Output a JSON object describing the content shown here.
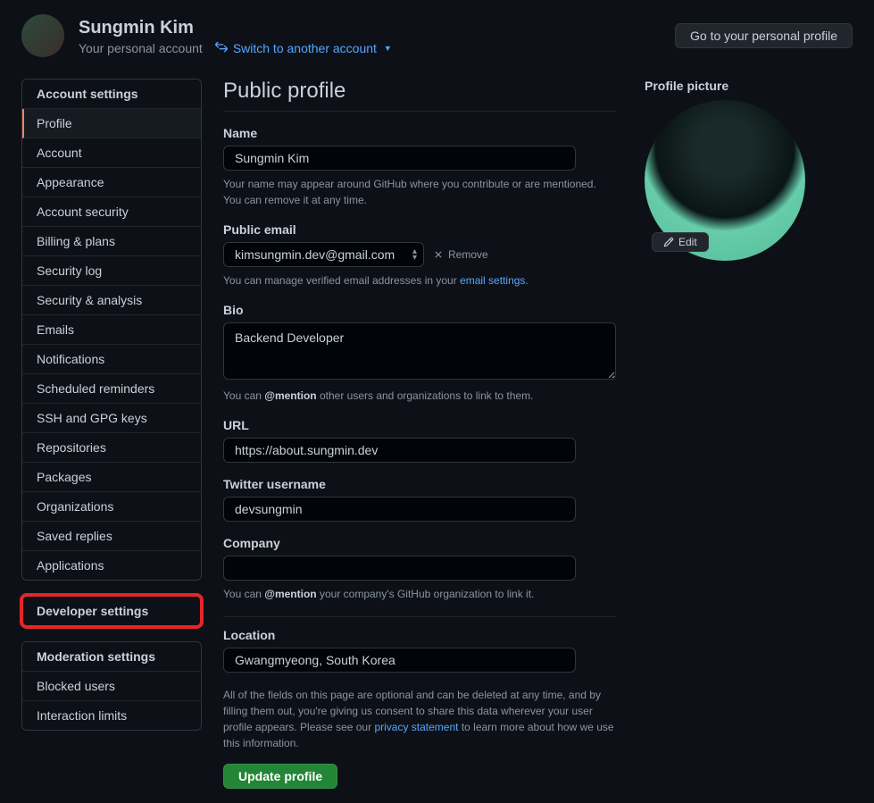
{
  "header": {
    "username": "Sungmin Kim",
    "subtitle": "Your personal account",
    "switch_label": "Switch to another account",
    "profile_button": "Go to your personal profile"
  },
  "sidebar": {
    "account_settings_header": "Account settings",
    "items": [
      "Profile",
      "Account",
      "Appearance",
      "Account security",
      "Billing & plans",
      "Security log",
      "Security & analysis",
      "Emails",
      "Notifications",
      "Scheduled reminders",
      "SSH and GPG keys",
      "Repositories",
      "Packages",
      "Organizations",
      "Saved replies",
      "Applications"
    ],
    "developer_settings": "Developer settings",
    "moderation_header": "Moderation settings",
    "moderation_items": [
      "Blocked users",
      "Interaction limits"
    ]
  },
  "main": {
    "title": "Public profile",
    "name": {
      "label": "Name",
      "value": "Sungmin Kim",
      "hint": "Your name may appear around GitHub where you contribute or are mentioned. You can remove it at any time."
    },
    "email": {
      "label": "Public email",
      "value": "kimsungmin.dev@gmail.com",
      "remove": "Remove",
      "hint_pre": "You can manage verified email addresses in your ",
      "hint_link": "email settings",
      "hint_post": "."
    },
    "bio": {
      "label": "Bio",
      "value": "Backend Developer",
      "hint_pre": "You can ",
      "hint_strong": "@mention",
      "hint_post": " other users and organizations to link to them."
    },
    "url": {
      "label": "URL",
      "value": "https://about.sungmin.dev"
    },
    "twitter": {
      "label": "Twitter username",
      "value": "devsungmin"
    },
    "company": {
      "label": "Company",
      "value": "",
      "hint_pre": "You can ",
      "hint_strong": "@mention",
      "hint_post": " your company's GitHub organization to link it."
    },
    "location": {
      "label": "Location",
      "value": "Gwangmyeong, South Korea"
    },
    "disclaimer_pre": "All of the fields on this page are optional and can be deleted at any time, and by filling them out, you're giving us consent to share this data wherever your user profile appears. Please see our ",
    "disclaimer_link": "privacy statement",
    "disclaimer_post": " to learn more about how we use this information.",
    "update_button": "Update profile",
    "picture": {
      "label": "Profile picture",
      "edit": "Edit"
    }
  }
}
